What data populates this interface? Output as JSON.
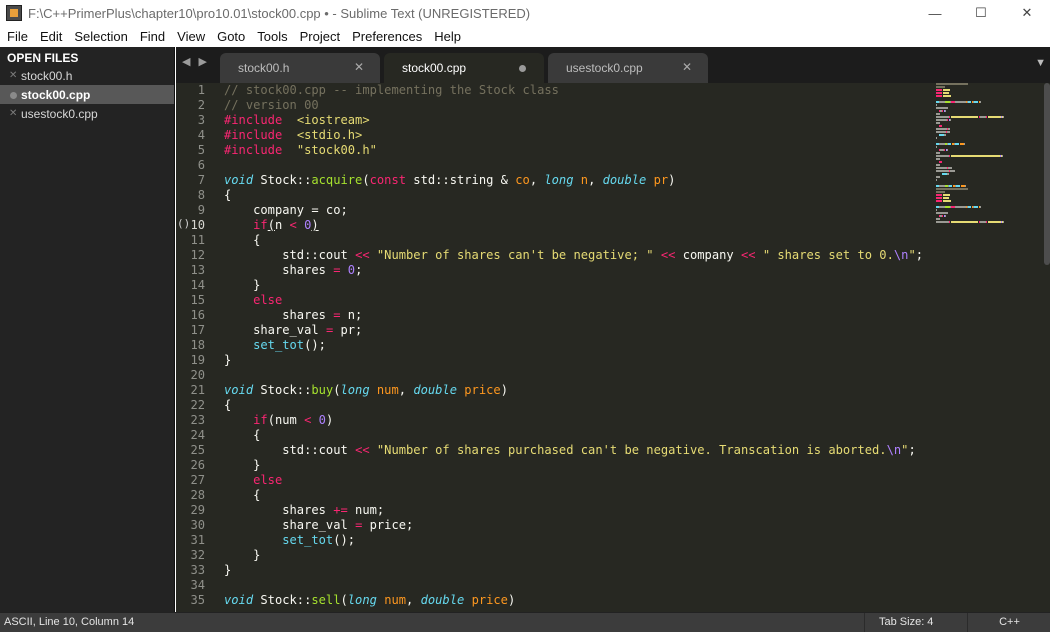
{
  "window": {
    "title": "F:\\C++PrimerPlus\\chapter10\\pro10.01\\stock00.cpp • - Sublime Text (UNREGISTERED)",
    "minimize_glyph": "—",
    "maximize_glyph": "☐",
    "close_glyph": "✕"
  },
  "menu": [
    "File",
    "Edit",
    "Selection",
    "Find",
    "View",
    "Goto",
    "Tools",
    "Project",
    "Preferences",
    "Help"
  ],
  "sidebar": {
    "header": "OPEN FILES",
    "files": [
      {
        "name": "stock00.h",
        "active": false,
        "dirty": false
      },
      {
        "name": "stock00.cpp",
        "active": true,
        "dirty": true
      },
      {
        "name": "usestock0.cpp",
        "active": false,
        "dirty": false
      }
    ]
  },
  "tabs": [
    {
      "label": "stock00.h",
      "active": false,
      "dirty": false
    },
    {
      "label": "stock00.cpp",
      "active": true,
      "dirty": true
    },
    {
      "label": "usestock0.cpp",
      "active": false,
      "dirty": false
    }
  ],
  "tab_nav": {
    "prev": "◀",
    "next": "▶",
    "overflow": "▼"
  },
  "editor": {
    "fold_marker": "()",
    "current_line": 10,
    "line_numbers": [
      "1",
      "2",
      "3",
      "4",
      "5",
      "6",
      "7",
      "8",
      "9",
      "10",
      "11",
      "12",
      "13",
      "14",
      "15",
      "16",
      "17",
      "18",
      "19",
      "20",
      "21",
      "22",
      "23",
      "24",
      "25",
      "26",
      "27",
      "28",
      "29",
      "30",
      "31",
      "32",
      "33",
      "34",
      "35"
    ],
    "lines": [
      [
        [
          "c-comment",
          "// stock00.cpp -- implementing the Stock class"
        ]
      ],
      [
        [
          "c-comment",
          "// version 00"
        ]
      ],
      [
        [
          "c-kw",
          "#include"
        ],
        [
          "",
          "  "
        ],
        [
          "c-str",
          "<iostream>"
        ]
      ],
      [
        [
          "c-kw",
          "#include"
        ],
        [
          "",
          "  "
        ],
        [
          "c-str",
          "<stdio.h>"
        ]
      ],
      [
        [
          "c-kw",
          "#include"
        ],
        [
          "",
          "  "
        ],
        [
          "c-str",
          "\"stock00.h\""
        ]
      ],
      [],
      [
        [
          "c-type",
          "void"
        ],
        [
          "",
          " Stock::"
        ],
        [
          "c-fn",
          "acquire"
        ],
        [
          "",
          "("
        ],
        [
          "c-kw",
          "const"
        ],
        [
          "",
          " std::string & "
        ],
        [
          "c-param",
          "co"
        ],
        [
          "",
          ", "
        ],
        [
          "c-type",
          "long"
        ],
        [
          "",
          " "
        ],
        [
          "c-param",
          "n"
        ],
        [
          "",
          ", "
        ],
        [
          "c-type",
          "double"
        ],
        [
          "",
          " "
        ],
        [
          "c-param",
          "pr"
        ],
        [
          "",
          ")"
        ]
      ],
      [
        [
          "",
          "{"
        ]
      ],
      [
        [
          "",
          "    company = co;"
        ]
      ],
      [
        [
          "",
          "    "
        ],
        [
          "c-kw",
          "if"
        ],
        [
          "c-under",
          "("
        ],
        [
          "",
          "n "
        ],
        [
          "c-kw",
          "<"
        ],
        [
          "",
          " "
        ],
        [
          "c-num",
          "0"
        ],
        [
          "c-under",
          ")"
        ]
      ],
      [
        [
          "",
          "    {"
        ]
      ],
      [
        [
          "",
          "        std::cout "
        ],
        [
          "c-kw",
          "<<"
        ],
        [
          "",
          " "
        ],
        [
          "c-str",
          "\"Number of shares can't be negative; \""
        ],
        [
          "",
          " "
        ],
        [
          "c-kw",
          "<<"
        ],
        [
          "",
          " company "
        ],
        [
          "c-kw",
          "<<"
        ],
        [
          "",
          " "
        ],
        [
          "c-str",
          "\" shares set to 0."
        ],
        [
          "c-esc",
          "\\n"
        ],
        [
          "c-str",
          "\""
        ],
        [
          "",
          ";"
        ]
      ],
      [
        [
          "",
          "        shares "
        ],
        [
          "c-kw",
          "="
        ],
        [
          "",
          " "
        ],
        [
          "c-num",
          "0"
        ],
        [
          "",
          ";"
        ]
      ],
      [
        [
          "",
          "    }"
        ]
      ],
      [
        [
          "",
          "    "
        ],
        [
          "c-kw",
          "else"
        ]
      ],
      [
        [
          "",
          "        shares "
        ],
        [
          "c-kw",
          "="
        ],
        [
          "",
          " n;"
        ]
      ],
      [
        [
          "",
          "    share_val "
        ],
        [
          "c-kw",
          "="
        ],
        [
          "",
          " pr;"
        ]
      ],
      [
        [
          "",
          "    "
        ],
        [
          "c-call",
          "set_tot"
        ],
        [
          "",
          "();"
        ]
      ],
      [
        [
          "",
          "}"
        ]
      ],
      [],
      [
        [
          "c-type",
          "void"
        ],
        [
          "",
          " Stock::"
        ],
        [
          "c-fn",
          "buy"
        ],
        [
          "",
          "("
        ],
        [
          "c-type",
          "long"
        ],
        [
          "",
          " "
        ],
        [
          "c-param",
          "num"
        ],
        [
          "",
          ", "
        ],
        [
          "c-type",
          "double"
        ],
        [
          "",
          " "
        ],
        [
          "c-param",
          "price"
        ],
        [
          "",
          ")"
        ]
      ],
      [
        [
          "",
          "{"
        ]
      ],
      [
        [
          "",
          "    "
        ],
        [
          "c-kw",
          "if"
        ],
        [
          "",
          "(num "
        ],
        [
          "c-kw",
          "<"
        ],
        [
          "",
          " "
        ],
        [
          "c-num",
          "0"
        ],
        [
          "",
          ")"
        ]
      ],
      [
        [
          "",
          "    {"
        ]
      ],
      [
        [
          "",
          "        std::cout "
        ],
        [
          "c-kw",
          "<<"
        ],
        [
          "",
          " "
        ],
        [
          "c-str",
          "\"Number of shares purchased can't be negative. Transcation is aborted."
        ],
        [
          "c-esc",
          "\\n"
        ],
        [
          "c-str",
          "\""
        ],
        [
          "",
          ";"
        ]
      ],
      [
        [
          "",
          "    }"
        ]
      ],
      [
        [
          "",
          "    "
        ],
        [
          "c-kw",
          "else"
        ]
      ],
      [
        [
          "",
          "    {"
        ]
      ],
      [
        [
          "",
          "        shares "
        ],
        [
          "c-kw",
          "+="
        ],
        [
          "",
          " num;"
        ]
      ],
      [
        [
          "",
          "        share_val "
        ],
        [
          "c-kw",
          "="
        ],
        [
          "",
          " price;"
        ]
      ],
      [
        [
          "",
          "        "
        ],
        [
          "c-call",
          "set_tot"
        ],
        [
          "",
          "();"
        ]
      ],
      [
        [
          "",
          "    }"
        ]
      ],
      [
        [
          "",
          "}"
        ]
      ],
      [],
      [
        [
          "c-type",
          "void"
        ],
        [
          "",
          " Stock::"
        ],
        [
          "c-fn",
          "sell"
        ],
        [
          "",
          "("
        ],
        [
          "c-type",
          "long"
        ],
        [
          "",
          " "
        ],
        [
          "c-param",
          "num"
        ],
        [
          "",
          ", "
        ],
        [
          "c-type",
          "double"
        ],
        [
          "",
          " "
        ],
        [
          "c-param",
          "price"
        ],
        [
          "",
          ")"
        ]
      ]
    ]
  },
  "status": {
    "left": "ASCII, Line 10, Column 14",
    "tab_size": "Tab Size: 4",
    "syntax": "C++"
  },
  "colors": {
    "editor_bg": "#272822",
    "sidebar_bg": "#232323",
    "comment": "#75715e",
    "keyword": "#f92672",
    "type": "#66d9ef",
    "function": "#a6e22e",
    "string": "#e6db74",
    "number": "#ae81ff",
    "parameter": "#fd971f"
  }
}
